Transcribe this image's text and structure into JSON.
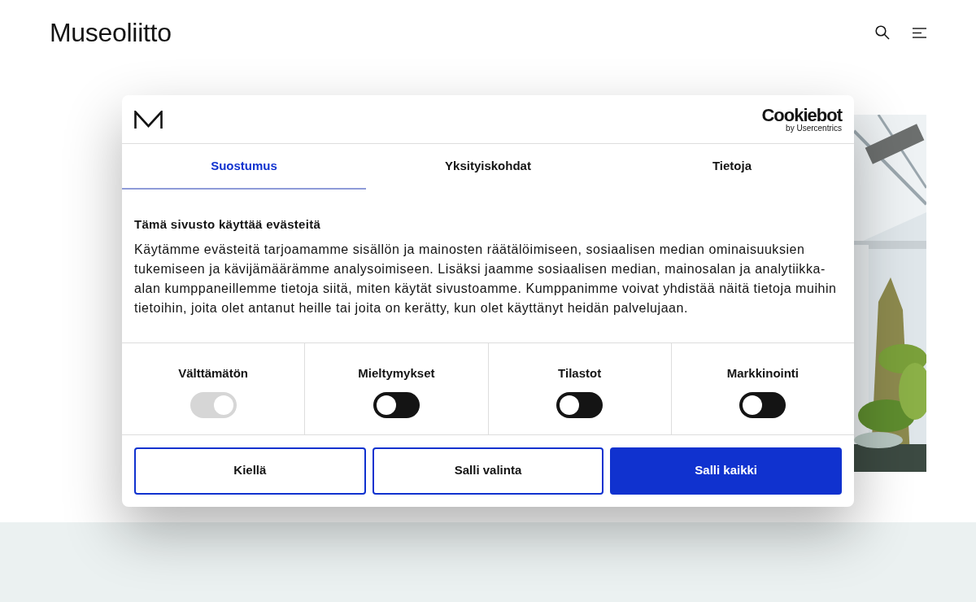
{
  "header": {
    "logo": "Museoliitto"
  },
  "consent": {
    "brand": {
      "title": "Cookiebot",
      "subtitle": "by Usercentrics"
    },
    "tabs": [
      {
        "label": "Suostumus",
        "selected": true
      },
      {
        "label": "Yksityiskohdat",
        "selected": false
      },
      {
        "label": "Tietoja",
        "selected": false
      }
    ],
    "heading": "Tämä sivusto käyttää evästeitä",
    "text": "Käytämme evästeitä tarjoamamme sisällön ja mainosten räätälöimiseen, sosiaalisen median ominaisuuksien tukemiseen ja kävijämäärämme analysoimiseen. Lisäksi jaamme sosiaalisen median, mainosalan ja analytiikka-alan kumppaneillemme tietoja siitä, miten käytät sivustoamme. Kumppanimme voivat yhdistää näitä tietoja muihin tietoihin, joita olet antanut heille tai joita on kerätty, kun olet käyttänyt heidän palvelujaan.",
    "categories": [
      {
        "label": "Välttämätön",
        "on": true,
        "disabled": true
      },
      {
        "label": "Mieltymykset",
        "on": false,
        "disabled": false
      },
      {
        "label": "Tilastot",
        "on": false,
        "disabled": false
      },
      {
        "label": "Markkinointi",
        "on": false,
        "disabled": false
      }
    ],
    "buttons": [
      {
        "label": "Kiellä",
        "kind": "outline"
      },
      {
        "label": "Salli valinta",
        "kind": "outline"
      },
      {
        "label": "Salli kaikki",
        "kind": "primary"
      }
    ]
  }
}
